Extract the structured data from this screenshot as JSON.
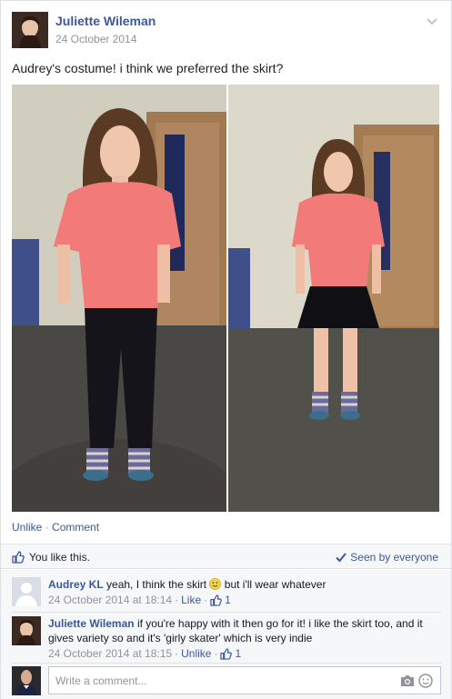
{
  "post": {
    "author": "Juliette Wileman",
    "date": "24 October 2014",
    "caption": "Audrey's costume! i think we preferred the skirt?"
  },
  "actions": {
    "unlike": "Unlike",
    "separator": "·",
    "comment": "Comment"
  },
  "likes": {
    "text": "You like this.",
    "seen": "Seen by everyone"
  },
  "comments": [
    {
      "name": "Audrey KL",
      "text_before_emoji": "yeah, I think the skirt",
      "text_after_emoji": "but i'll wear whatever",
      "timestamp": "24 October 2014 at 18:14",
      "action": "Like",
      "like_count": "1"
    },
    {
      "name": "Juliette Wileman",
      "text": "if you're happy with it then go for it! i like the skirt too, and it gives variety so and it's 'girly skater' which is very indie",
      "timestamp": "24 October 2014 at 18:15",
      "action": "Unlike",
      "like_count": "1"
    }
  ],
  "write_comment": {
    "placeholder": "Write a comment..."
  },
  "icons": {
    "chevron": "chevron-down-icon",
    "thumb": "thumbs-up-icon",
    "check": "checkmark-icon",
    "camera": "camera-icon",
    "emoji": "smiley-icon"
  },
  "colors": {
    "link": "#3b5998",
    "meta": "#90949c"
  }
}
